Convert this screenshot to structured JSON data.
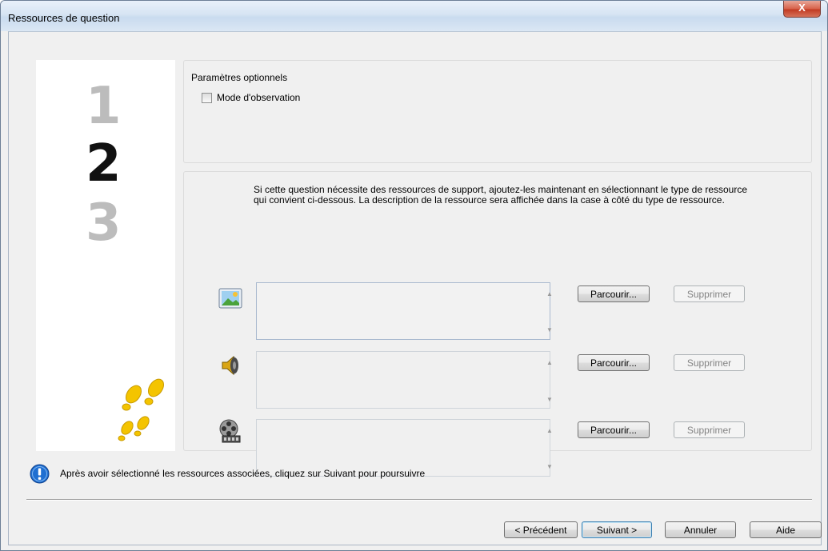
{
  "window": {
    "title": "Ressources de question",
    "close_label": "X"
  },
  "steps": {
    "step1": "1",
    "step2": "2",
    "step3": "3"
  },
  "optional": {
    "heading": "Paramètres optionnels",
    "observation_label": "Mode d'observation",
    "observation_checked": false
  },
  "resources": {
    "description": "Si cette question nécessite des ressources de support, ajoutez-les maintenant en sélectionnant le type de ressource qui convient ci-dessous. La description de la ressource sera affichée dans la case à côté du type de ressource.",
    "items": [
      {
        "type": "image",
        "icon": "image-icon",
        "value": "",
        "browse_label": "Parcourir...",
        "delete_label": "Supprimer"
      },
      {
        "type": "audio",
        "icon": "speaker-icon",
        "value": "",
        "browse_label": "Parcourir...",
        "delete_label": "Supprimer"
      },
      {
        "type": "video",
        "icon": "film-reel-icon",
        "value": "",
        "browse_label": "Parcourir...",
        "delete_label": "Supprimer"
      }
    ]
  },
  "info": {
    "message": "Après avoir sélectionné les ressources associées, cliquez sur Suivant pour poursuivre"
  },
  "nav": {
    "prev_label": "< Précédent",
    "next_label": "Suivant >",
    "cancel_label": "Annuler",
    "help_label": "Aide"
  },
  "colors": {
    "footprints": "#f4c400",
    "info_icon": "#1f6fd1"
  }
}
